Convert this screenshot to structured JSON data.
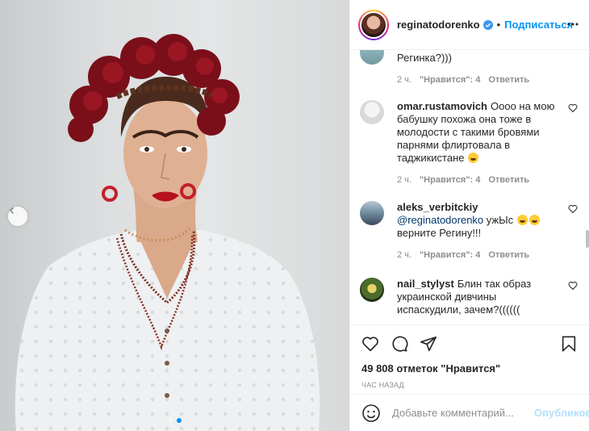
{
  "header": {
    "username": "reginatodorenko",
    "separator": "•",
    "follow_label": "Подписаться"
  },
  "comments": [
    {
      "partial": true,
      "text": "Регинка?)))",
      "time": "2 ч.",
      "likes": "\"Нравится\": 4",
      "reply": "Ответить"
    },
    {
      "user": "omar.rustamovich",
      "text": "Оооо на мою бабушку похожа она тоже в молодости с такими бровями парнями флиртовала в таджикистане",
      "emoji": "grinning-face-emoji",
      "time": "2 ч.",
      "likes": "\"Нравится\": 4",
      "reply": "Ответить"
    },
    {
      "user": "aleks_verbitckiy",
      "mention": "@reginatodorenko",
      "text_a": "ужЫс",
      "text_b": "верните Регину!!!",
      "time": "2 ч.",
      "likes": "\"Нравится\": 4",
      "reply": "Ответить"
    },
    {
      "user": "nail_stylyst",
      "text": "Блин так образ украинской дивчины испаскудили, зачем?(((((("
    }
  ],
  "actions": {
    "likes_count": "49 808 отметок \"Нравится\"",
    "time_ago": "ЧАС НАЗАД"
  },
  "add_comment": {
    "placeholder": "Добавьте комментарий...",
    "publish_label": "Опубликовать"
  },
  "colors": {
    "accent": "#0095f6",
    "publish_disabled": "#b2dffc",
    "meta_gray": "#8e8e8e",
    "text": "#262626"
  },
  "carousel": {
    "total_slides": 2,
    "active_slide": 2
  }
}
